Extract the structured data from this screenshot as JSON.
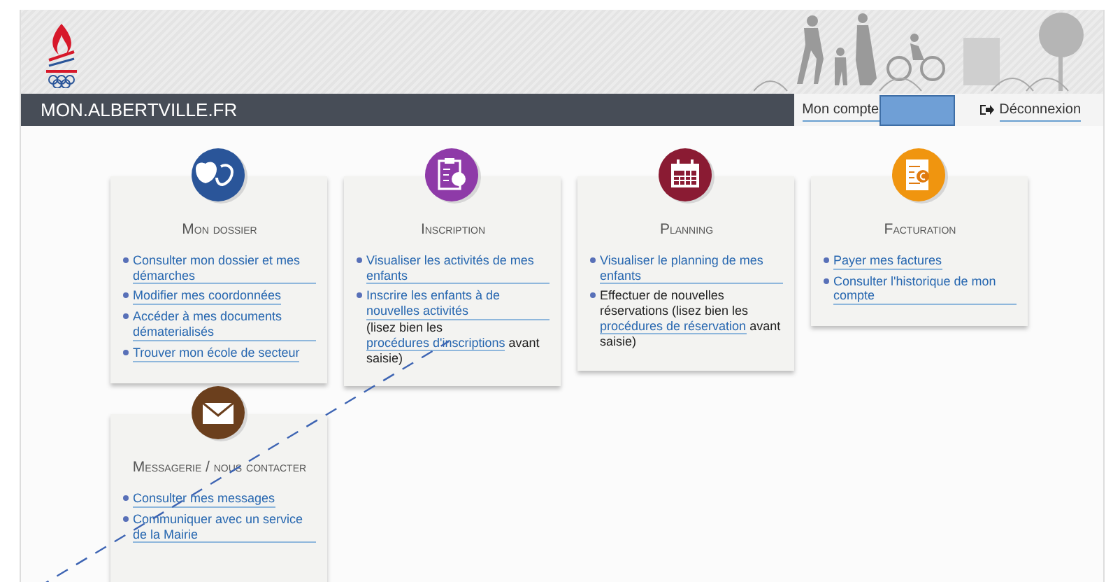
{
  "header": {
    "site_title": "MON.ALBERTVILLE.FR",
    "account_label": "Mon compte",
    "logout": "Déconnexion"
  },
  "cards": [
    {
      "title": "Mon dossier",
      "color": "#2a5599",
      "items": [
        [
          {
            "kind": "link",
            "text": "Consulter mon dossier et mes démarches"
          }
        ],
        [
          {
            "kind": "link",
            "text": "Modifier mes coordonnées"
          }
        ],
        [
          {
            "kind": "link",
            "text": "Accéder à mes documents dématerialisés"
          }
        ],
        [
          {
            "kind": "link",
            "text": "Trouver mon école de secteur"
          }
        ]
      ]
    },
    {
      "title": "Inscription",
      "color": "#8e3aa8",
      "items": [
        [
          {
            "kind": "link",
            "text": "Visualiser les activités de mes enfants"
          }
        ],
        [
          {
            "kind": "link",
            "text": "Inscrire les enfants à de nouvelles activités"
          },
          {
            "kind": "text",
            "text": " (lisez bien les "
          },
          {
            "kind": "link",
            "text": "procédures d'inscriptions"
          },
          {
            "kind": "text",
            "text": " avant saisie)"
          }
        ]
      ]
    },
    {
      "title": "Planning",
      "color": "#8a1b33",
      "items": [
        [
          {
            "kind": "link",
            "text": "Visualiser le planning de mes enfants"
          }
        ],
        [
          {
            "kind": "text",
            "text": "Effectuer de nouvelles réservations (lisez bien les "
          },
          {
            "kind": "link",
            "text": "procédures de réservation"
          },
          {
            "kind": "text",
            "text": " avant saisie)"
          }
        ]
      ]
    },
    {
      "title": "Facturation",
      "color": "#f0950f",
      "items": [
        [
          {
            "kind": "link",
            "text": "Payer mes factures"
          }
        ],
        [
          {
            "kind": "link",
            "text": "Consulter l'historique de mon compte"
          }
        ]
      ]
    },
    {
      "title": "Messagerie / nous contacter",
      "color": "#6b3f1d",
      "items": [
        [
          {
            "kind": "link",
            "text": "Consulter mes messages"
          }
        ],
        [
          {
            "kind": "link",
            "text": "Communiquer avec un service de la Mairie"
          }
        ]
      ]
    }
  ]
}
